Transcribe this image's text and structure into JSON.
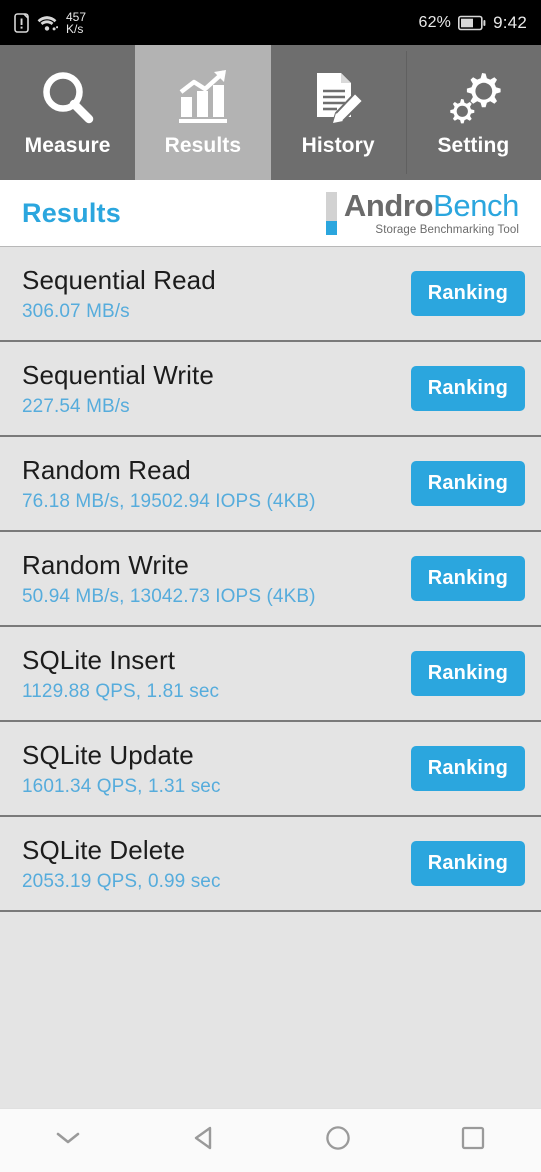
{
  "statusbar": {
    "sim_icon": "sim-alert-icon",
    "wifi_icon": "wifi-icon",
    "network_speed_value": "457",
    "network_speed_unit": "K/s",
    "battery_percent": "62%",
    "battery_icon": "battery-icon",
    "time": "9:42"
  },
  "tabs": [
    {
      "label": "Measure",
      "icon": "magnifier-icon",
      "selected": false
    },
    {
      "label": "Results",
      "icon": "bar-chart-arrow-icon",
      "selected": true
    },
    {
      "label": "History",
      "icon": "document-pencil-icon",
      "selected": false
    },
    {
      "label": "Setting",
      "icon": "gears-icon",
      "selected": false
    }
  ],
  "header": {
    "page_title": "Results",
    "logo_word_1": "Andro",
    "logo_word_2": "Bench",
    "logo_subtitle": "Storage Benchmarking Tool"
  },
  "results": {
    "ranking_label": "Ranking",
    "rows": [
      {
        "title": "Sequential Read",
        "value": "306.07 MB/s"
      },
      {
        "title": "Sequential Write",
        "value": "227.54 MB/s"
      },
      {
        "title": "Random Read",
        "value": "76.18 MB/s, 19502.94 IOPS (4KB)"
      },
      {
        "title": "Random Write",
        "value": "50.94 MB/s, 13042.73 IOPS (4KB)"
      },
      {
        "title": "SQLite Insert",
        "value": "1129.88 QPS, 1.81 sec"
      },
      {
        "title": "SQLite Update",
        "value": "1601.34 QPS, 1.31 sec"
      },
      {
        "title": "SQLite Delete",
        "value": "2053.19 QPS, 0.99 sec"
      }
    ]
  },
  "navbar": {
    "buttons": [
      {
        "icon": "chevron-down-icon"
      },
      {
        "icon": "back-triangle-icon"
      },
      {
        "icon": "home-circle-icon"
      },
      {
        "icon": "recents-square-icon"
      }
    ]
  },
  "colors": {
    "accent_blue": "#2BA6DE",
    "value_blue": "#56ACDC",
    "tab_bg": "#6E6E6E",
    "tab_selected_bg": "#B3B3B3",
    "list_bg": "#E4E4E4",
    "separator": "#7A7A7A"
  }
}
